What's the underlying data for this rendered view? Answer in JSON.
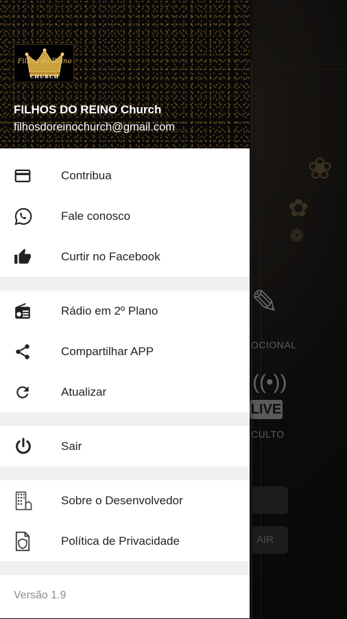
{
  "header": {
    "logo_line1": "Filhos do Reino",
    "logo_line2": "CHURCH",
    "name": "FILHOS DO REINO Church",
    "email": "filhosdoreinochurch@gmail.com"
  },
  "menu_groups": [
    {
      "items": [
        {
          "label": "Contribua",
          "icon": "credit-card-icon"
        },
        {
          "label": "Fale conosco",
          "icon": "whatsapp-icon"
        },
        {
          "label": "Curtir no Facebook",
          "icon": "thumbs-up-icon"
        }
      ]
    },
    {
      "items": [
        {
          "label": "Rádio em 2º Plano",
          "icon": "radio-icon"
        },
        {
          "label": "Compartilhar APP",
          "icon": "share-icon"
        },
        {
          "label": "Atualizar",
          "icon": "refresh-icon"
        }
      ]
    },
    {
      "items": [
        {
          "label": "Sair",
          "icon": "power-icon"
        }
      ]
    },
    {
      "items": [
        {
          "label": "Sobre o Desenvolvedor",
          "icon": "building-icon"
        },
        {
          "label": "Política de Privacidade",
          "icon": "shield-document-icon"
        }
      ]
    }
  ],
  "version": "Versão 1.9",
  "background": {
    "label_devocional": "OCIONAL",
    "live_badge": "LIVE",
    "label_culto": "CULTO",
    "button_sair": "AIR"
  }
}
